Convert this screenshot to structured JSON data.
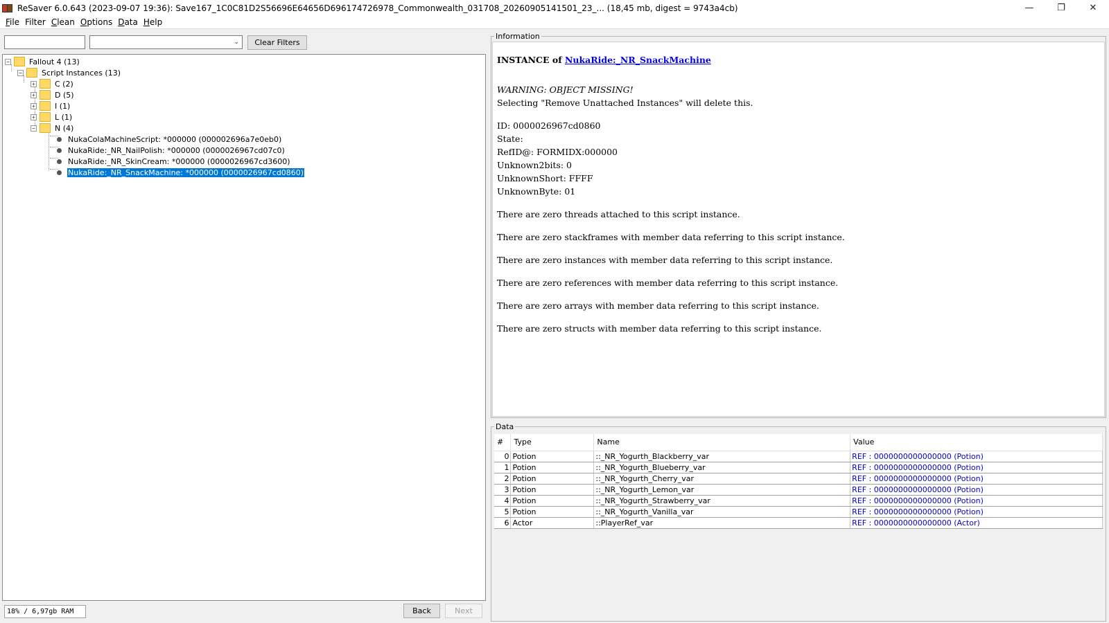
{
  "window": {
    "title": "ReSaver 6.0.643 (2023-09-07 19:36): Save167_1C0C81D2S56696E64656D696174726978_Commonwealth_031708_20260905141501_23_... (18,45 mb, digest = 9743a4cb)",
    "minimize": "—",
    "maximize": "❐",
    "close": "✕"
  },
  "menu": [
    {
      "mnemonic": "F",
      "rest": "ile"
    },
    {
      "mnemonic": "",
      "rest": "Filter"
    },
    {
      "mnemonic": "C",
      "rest": "lean"
    },
    {
      "mnemonic": "O",
      "rest": "ptions"
    },
    {
      "mnemonic": "D",
      "rest": "ata"
    },
    {
      "mnemonic": "H",
      "rest": "elp"
    }
  ],
  "filter": {
    "text_value": "",
    "combo_value": "",
    "clear_label": "Clear Filters"
  },
  "tree": {
    "root": "Fallout 4 (13)",
    "script_instances": "Script Instances (13)",
    "groups": [
      "C (2)",
      "D (5)",
      "I (1)",
      "L (1)",
      "N (4)"
    ],
    "leaves": [
      "NukaColaMachineScript: *000000 (000002696a7e0eb0)",
      "NukaRide:_NR_NailPolish: *000000 (0000026967cd07c0)",
      "NukaRide:_NR_SkinCream: *000000 (0000026967cd3600)",
      "NukaRide:_NR_SnackMachine: *000000 (0000026967cd0860)"
    ]
  },
  "status": {
    "memory": "18% / 6,97gb RAM",
    "back_label": "Back",
    "next_label": "Next"
  },
  "info": {
    "group_label": "Information",
    "title_prefix": "INSTANCE of ",
    "title_link": "NukaRide:_NR_SnackMachine",
    "warning": "WARNING: OBJECT MISSING!",
    "warning_note": "Selecting \"Remove Unattached Instances\" will delete this.",
    "fields": [
      "ID: 0000026967cd0860",
      "State:",
      "RefID@: FORMIDX:000000",
      "Unknown2bits: 0",
      "UnknownShort: FFFF",
      "UnknownByte: 01"
    ],
    "notes": [
      "There are zero threads attached to this script instance.",
      "There are zero stackframes with member data referring to this script instance.",
      "There are zero instances with member data referring to this script instance.",
      "There are zero references with member data referring to this script instance.",
      "There are zero arrays with member data referring to this script instance.",
      "There are zero structs with member data referring to this script instance."
    ]
  },
  "data": {
    "group_label": "Data",
    "columns": [
      "#",
      "Type",
      "Name",
      "Value"
    ],
    "rows": [
      {
        "idx": "0",
        "type": "Potion",
        "name": "::_NR_Yogurth_Blackberry_var",
        "value": "REF : 0000000000000000 (Potion)"
      },
      {
        "idx": "1",
        "type": "Potion",
        "name": "::_NR_Yogurth_Blueberry_var",
        "value": "REF : 0000000000000000 (Potion)"
      },
      {
        "idx": "2",
        "type": "Potion",
        "name": "::_NR_Yogurth_Cherry_var",
        "value": "REF : 0000000000000000 (Potion)"
      },
      {
        "idx": "3",
        "type": "Potion",
        "name": "::_NR_Yogurth_Lemon_var",
        "value": "REF : 0000000000000000 (Potion)"
      },
      {
        "idx": "4",
        "type": "Potion",
        "name": "::_NR_Yogurth_Strawberry_var",
        "value": "REF : 0000000000000000 (Potion)"
      },
      {
        "idx": "5",
        "type": "Potion",
        "name": "::_NR_Yogurth_Vanilla_var",
        "value": "REF : 0000000000000000 (Potion)"
      },
      {
        "idx": "6",
        "type": "Actor",
        "name": "::PlayerRef_var",
        "value": "REF : 0000000000000000 (Actor)"
      }
    ]
  }
}
